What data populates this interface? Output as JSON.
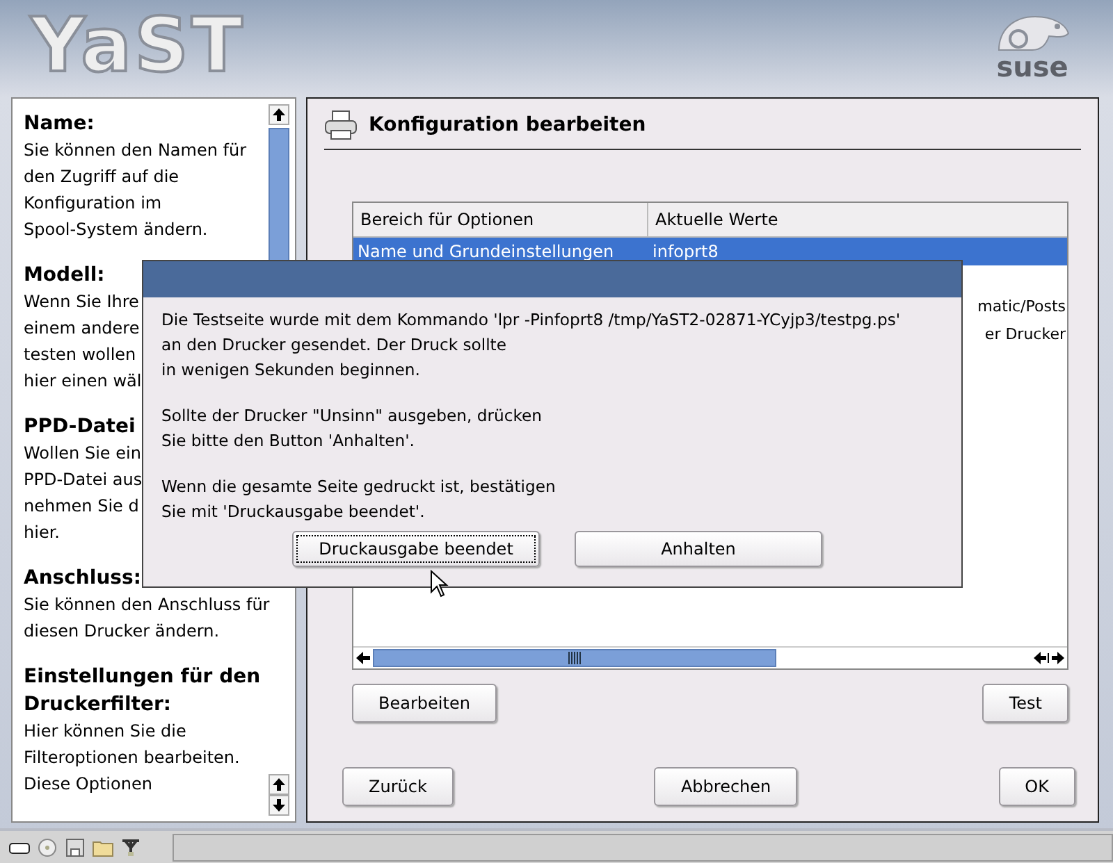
{
  "header": {
    "logo": "YaST",
    "brand": "suse"
  },
  "help": {
    "sections": [
      {
        "heading": "Name:",
        "lines": [
          "Sie können den Namen für",
          "den Zugriff auf die",
          "Konfiguration im",
          "Spool-System ändern."
        ]
      },
      {
        "heading": "Modell:",
        "lines": [
          "Wenn Sie Ihre",
          "einem andere",
          "testen wollen",
          "hier einen wäl"
        ]
      },
      {
        "heading": "PPD-Datei",
        "lines": [
          "Wollen Sie ein",
          "PPD-Datei aus",
          "nehmen Sie d",
          "hier."
        ]
      },
      {
        "heading": "Anschluss:",
        "lines": [
          "Sie können den Anschluss für",
          "diesen Drucker ändern."
        ]
      },
      {
        "heading": "Einstellungen für den Druckerfilter:",
        "lines": [
          "Hier können Sie die",
          "Filteroptionen bearbeiten.",
          "Diese Optionen"
        ]
      }
    ]
  },
  "main": {
    "title": "Konfiguration bearbeiten",
    "table": {
      "columns": [
        "Bereich für Optionen",
        "Aktuelle Werte"
      ],
      "rows": [
        {
          "cells": [
            "Name und Grundeinstellungen",
            "infoprt8"
          ],
          "selected": true
        }
      ],
      "partial_values": [
        "matic/Posts",
        "er Drucker"
      ]
    },
    "table_buttons": [
      "Bearbeiten",
      "Test"
    ],
    "nav_buttons": [
      "Zurück",
      "Abbrechen",
      "OK"
    ]
  },
  "dialog": {
    "paragraphs": [
      [
        "Die Testseite wurde mit dem Kommando 'lpr -Pinfoprt8 /tmp/YaST2-02871-YCyjp3/testpg.ps'",
        "an den Drucker gesendet. Der Druck sollte",
        "in wenigen Sekunden beginnen."
      ],
      [
        "Sollte der Drucker \"Unsinn\" ausgeben, drücken",
        "Sie bitte den Button 'Anhalten'."
      ],
      [
        "Wenn die gesamte Seite gedruckt ist, bestätigen",
        "Sie mit 'Druckausgabe beendet'."
      ]
    ],
    "buttons": [
      {
        "label": "Druckausgabe beendet",
        "focused": true
      },
      {
        "label": "Anhalten",
        "focused": false
      }
    ]
  }
}
